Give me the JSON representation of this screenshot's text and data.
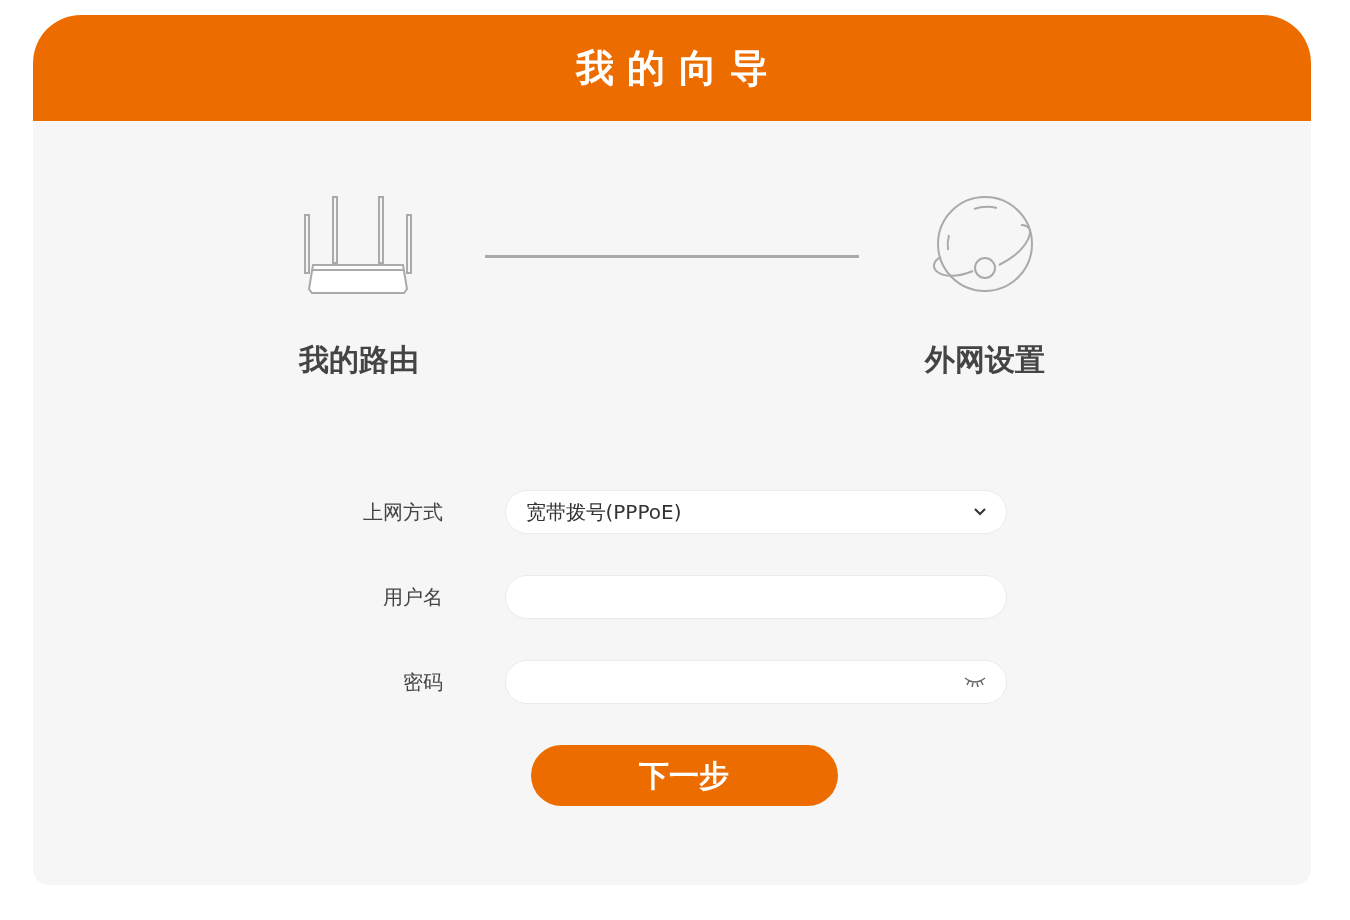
{
  "header": {
    "title": "我 的 向 导"
  },
  "steps": [
    {
      "label": "我的路由",
      "kind": "router"
    },
    {
      "label": "外网设置",
      "kind": "globe"
    }
  ],
  "form": {
    "fields": [
      {
        "label": "上网方式",
        "kind": "select",
        "value": "宽带拨号(PPPoE)"
      },
      {
        "label": "用户名",
        "kind": "text"
      },
      {
        "label": "密码",
        "kind": "password"
      }
    ]
  },
  "next_button": "下一步"
}
